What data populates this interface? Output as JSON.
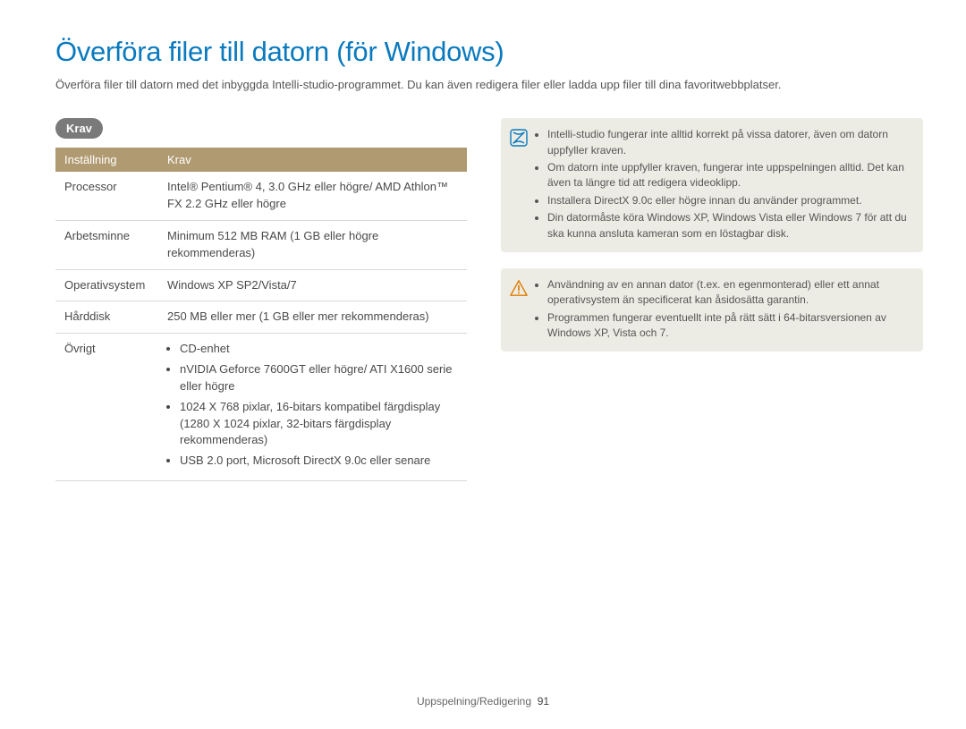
{
  "title": "Överföra filer till datorn (för Windows)",
  "intro": "Överföra filer till datorn med det inbyggda Intelli-studio-programmet. Du kan även redigera filer eller ladda upp filer till dina favoritwebbplatser.",
  "section_label": "Krav",
  "table": {
    "header": {
      "col1": "Inställning",
      "col2": "Krav"
    },
    "rows": {
      "processor": {
        "label": "Processor",
        "value": "Intel® Pentium® 4, 3.0 GHz eller högre/\nAMD Athlon™ FX 2.2 GHz eller högre"
      },
      "ram": {
        "label": "Arbetsminne",
        "value": "Minimum 512 MB RAM (1 GB eller högre rekommenderas)"
      },
      "os": {
        "label": "Operativsystem",
        "value": "Windows XP SP2/Vista/7"
      },
      "hdd": {
        "label": "Hårddisk",
        "value": "250 MB eller mer (1 GB eller mer rekommenderas)"
      },
      "other": {
        "label": "Övrigt",
        "items": [
          "CD-enhet",
          "nVIDIA Geforce 7600GT eller högre/\nATI X1600 serie eller högre",
          "1024 X 768 pixlar, 16-bitars kompatibel färgdisplay (1280 X 1024 pixlar, 32-bitars färgdisplay rekommenderas)",
          "USB 2.0 port, Microsoft DirectX 9.0c eller senare"
        ]
      }
    }
  },
  "info_box": {
    "items": [
      "Intelli-studio fungerar inte alltid korrekt på vissa datorer, även om datorn uppfyller kraven.",
      "Om datorn inte uppfyller kraven, fungerar inte uppspelningen alltid. Det kan även ta längre tid att redigera videoklipp.",
      "Installera DirectX 9.0c eller högre innan du använder programmet.",
      "Din datormåste köra Windows XP, Windows Vista eller Windows 7 för att du ska kunna ansluta kameran som en löstagbar disk."
    ]
  },
  "warn_box": {
    "items": [
      "Användning av en annan dator (t.ex. en egenmonterad) eller ett annat operativsystem än specificerat kan åsidosätta garantin.",
      "Programmen fungerar eventuellt inte på rätt sätt i 64-bitarsversionen av Windows XP, Vista och 7."
    ]
  },
  "footer": {
    "section": "Uppspelning/Redigering",
    "page": "91"
  }
}
